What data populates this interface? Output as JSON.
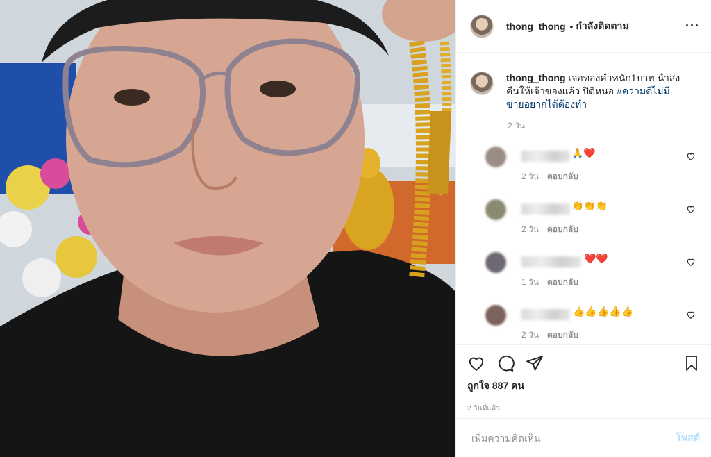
{
  "post": {
    "username": "thong_thong",
    "separator": "•",
    "follow_status": "กำลังติดตาม",
    "more": "···",
    "caption_text": "เจอทองคำหนัก1บาท นำส่งคืนให้เจ้าของแล้ว ปิดิหนอ",
    "caption_hashtag": "#ความดีไม่มีขายอยากได้ต้องทำ",
    "caption_time": "2 วัน"
  },
  "comments": [
    {
      "emoji": "🙏❤️",
      "time": "2 วัน",
      "reply": "ตอบกลับ"
    },
    {
      "emoji": "👏👏👏",
      "time": "2 วัน",
      "reply": "ตอบกลับ"
    },
    {
      "emoji": "❤️❤️",
      "time": "1 วัน",
      "reply": "ตอบกลับ"
    },
    {
      "emoji": "👍👍👍👍👍",
      "time": "2 วัน",
      "reply": "ตอบกลับ"
    }
  ],
  "stats": {
    "likes": "ถูกใจ 887 คน",
    "posted_ago": "2 วันที่แล้ว"
  },
  "composer": {
    "placeholder": "เพิ่มความคิดเห็น",
    "post_label": "โพสต์"
  },
  "colors": {
    "hashtag": "#00376b",
    "muted": "#8e8e8e",
    "post_disabled": "#b2dffc"
  }
}
